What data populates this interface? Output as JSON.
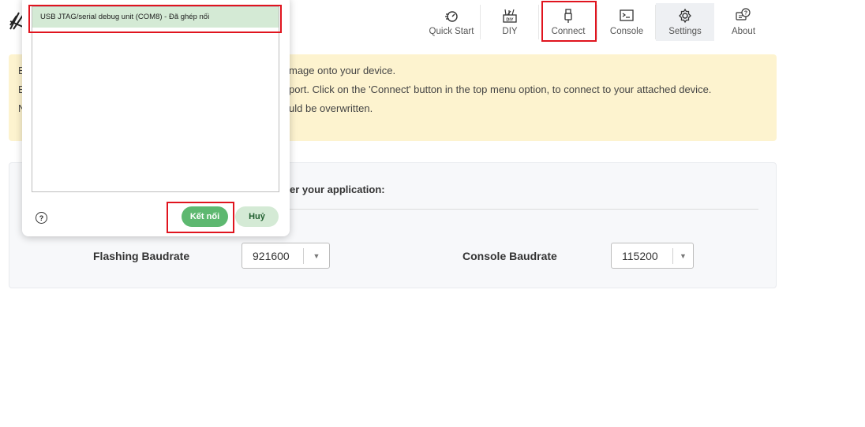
{
  "nav": {
    "items": [
      {
        "label": "Quick Start",
        "icon": "rocket-icon"
      },
      {
        "label": "DIY",
        "icon": "diy-icon"
      },
      {
        "label": "Connect",
        "icon": "usb-icon"
      },
      {
        "label": "Console",
        "icon": "terminal-icon"
      },
      {
        "label": "Settings",
        "icon": "gear-icon"
      },
      {
        "label": "About",
        "icon": "info-chat-icon"
      }
    ]
  },
  "banner": {
    "lines": [
      {
        "lead": "E",
        "text": "mage onto your device."
      },
      {
        "lead": "E",
        "text": "port. Click on the 'Connect' button in the top menu option, to connect to your attached device."
      },
      {
        "lead": "N",
        "text": "uld be overwritten."
      }
    ]
  },
  "panel": {
    "title": "er your application:",
    "flashing_label": "Flashing Baudrate",
    "flashing_value": "921600",
    "console_label": "Console Baudrate",
    "console_value": "115200"
  },
  "dialog": {
    "device": "USB JTAG/serial debug unit (COM8) - Đã ghép nối",
    "connect_label": "Kết nối",
    "cancel_label": "Huỷ",
    "help_symbol": "?"
  },
  "colors": {
    "highlight": "#e0141e",
    "banner": "#fdf3cf",
    "connect_button": "#5db870",
    "selected_device": "#d4ead5"
  }
}
